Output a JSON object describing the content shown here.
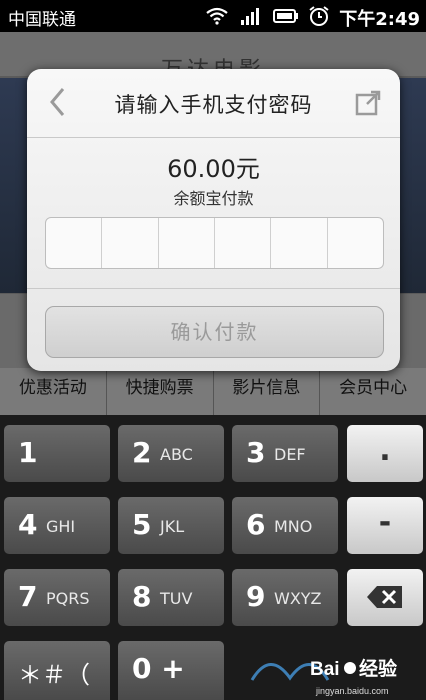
{
  "status_bar": {
    "carrier": "中国联通",
    "time": "下午2:49",
    "icons": [
      "wifi-icon",
      "signal-icon",
      "battery-icon",
      "alarm-icon"
    ]
  },
  "background_app": {
    "title": "万达电影",
    "tabs": [
      "优惠活动",
      "快捷购票",
      "影片信息",
      "会员中心"
    ]
  },
  "dialog": {
    "title": "请输入手机支付密码",
    "amount": "60.00元",
    "amount_label": "余额宝付款",
    "pin_length": 6,
    "confirm_label": "确认付款",
    "icons": {
      "back": "back-arrow-icon",
      "share": "share-icon"
    }
  },
  "keypad": {
    "keys": [
      {
        "num": "1",
        "letters": ""
      },
      {
        "num": "2",
        "letters": "ABC"
      },
      {
        "num": "3",
        "letters": "DEF"
      },
      {
        "num": "4",
        "letters": "GHI"
      },
      {
        "num": "5",
        "letters": "JKL"
      },
      {
        "num": "6",
        "letters": "MNO"
      },
      {
        "num": "7",
        "letters": "PQRS"
      },
      {
        "num": "8",
        "letters": "TUV"
      },
      {
        "num": "9",
        "letters": "WXYZ"
      },
      {
        "num": "＊＃（",
        "letters": ""
      },
      {
        "num": "0 +",
        "letters": ""
      }
    ],
    "side": {
      "dot": ".",
      "dash": "-",
      "backspace_icon": "backspace-icon"
    }
  },
  "watermark": {
    "text": "Baidu经验",
    "url": "jingyan.baidu.com"
  }
}
